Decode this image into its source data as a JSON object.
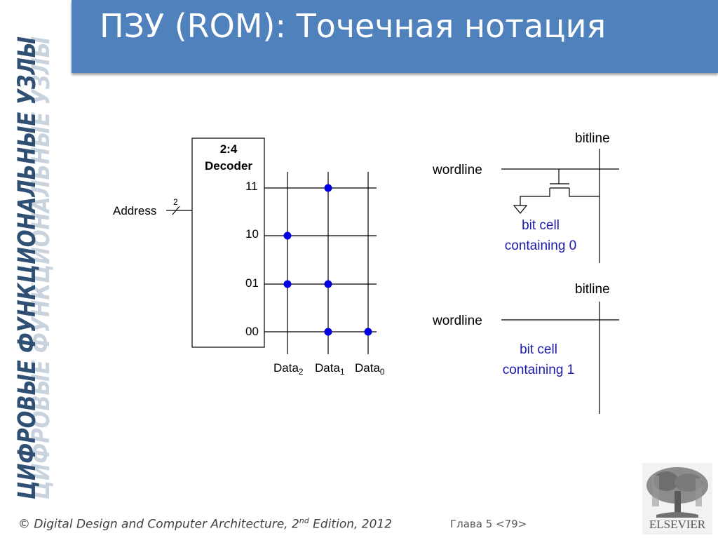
{
  "side_banner": {
    "text": "ЦИФРОВЫЕ ФУНКЦИОНАЛЬНЫЕ УЗЛЫ"
  },
  "title": "ПЗУ (ROM): Точечная нотация",
  "rom": {
    "decoder_type": "2:4",
    "decoder_name": "Decoder",
    "address_label": "Address",
    "address_width": "2",
    "rows": [
      "11",
      "10",
      "01",
      "00"
    ],
    "columns": [
      {
        "name": "Data",
        "sub": "2"
      },
      {
        "name": "Data",
        "sub": "1"
      },
      {
        "name": "Data",
        "sub": "0"
      }
    ],
    "dot_color": "#0000e0"
  },
  "cell0": {
    "bitline_label": "bitline",
    "wordline_label": "wordline",
    "caption_line1": "bit cell",
    "caption_line2": "containing 0"
  },
  "cell1": {
    "bitline_label": "bitline",
    "wordline_label": "wordline",
    "caption_line1": "bit cell",
    "caption_line2": "containing 1"
  },
  "caption_color": "#1a1aad",
  "footer": {
    "copyright_pre": "© Digital Design and Computer Architecture, 2",
    "copyright_sup": "nd",
    "copyright_post": " Edition, 2012",
    "page": "Глава 5 <79>",
    "publisher": "ELSEVIER"
  }
}
